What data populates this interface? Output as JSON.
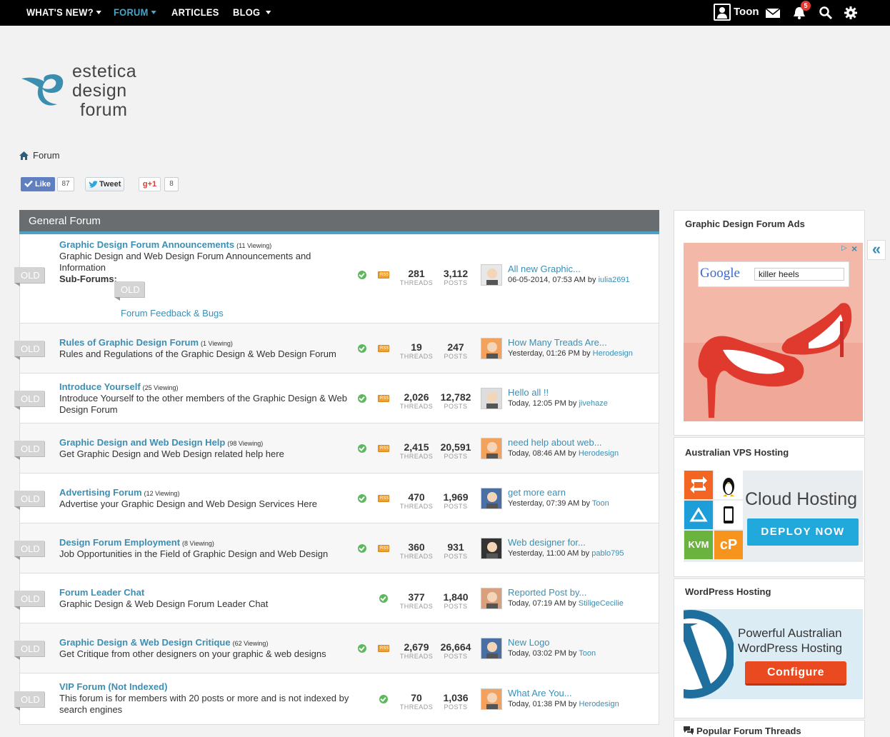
{
  "nav": {
    "whats_new": "WHAT'S NEW?",
    "forum": "FORUM",
    "articles": "ARTICLES",
    "blog": "BLOG",
    "user": "Toon",
    "notifications": "5"
  },
  "logo": {
    "line1": "estetica",
    "line2": "design",
    "line3": "forum"
  },
  "breadcrumb": "Forum",
  "social": {
    "like": "Like",
    "like_count": "87",
    "tweet": "Tweet",
    "gplus": "+1",
    "gplus_count": "8"
  },
  "forum": {
    "section": "General Forum",
    "old_label": "OLD",
    "threads_label": "THREADS",
    "posts_label": "POSTS",
    "rows": [
      {
        "title": "Graphic Design Forum Announcements",
        "viewing": "(11 Viewing)",
        "desc": "Graphic Design and Web Design Forum Announcements and Information",
        "subforums_label": "Sub-Forums:",
        "subforum": "Forum Feedback & Bugs",
        "threads": "281",
        "posts": "3,112",
        "lp_title": "All new Graphic...",
        "lp_date": "06-05-2014, 07:53 AM by",
        "lp_user": "iulia2691"
      },
      {
        "title": "Rules of Graphic Design Forum",
        "viewing": "(1 Viewing)",
        "desc": "Rules and Regulations of the Graphic Design & Web Design Forum",
        "threads": "19",
        "posts": "247",
        "lp_title": "How Many Treads Are...",
        "lp_date": "Yesterday, 01:26 PM by",
        "lp_user": "Herodesign"
      },
      {
        "title": "Introduce Yourself",
        "viewing": "(25 Viewing)",
        "desc": "Introduce Yourself to the other members of the Graphic Design & Web Design Forum",
        "threads": "2,026",
        "posts": "12,782",
        "lp_title": "Hello all !!",
        "lp_date": "Today, 12:05 PM by",
        "lp_user": "jivehaze"
      },
      {
        "title": "Graphic Design and Web Design Help",
        "viewing": "(98 Viewing)",
        "desc": "Get Graphic Design and Web Design related help here",
        "threads": "2,415",
        "posts": "20,591",
        "lp_title": "need help about web...",
        "lp_date": "Today, 08:46 AM by",
        "lp_user": "Herodesign"
      },
      {
        "title": "Advertising Forum",
        "viewing": "(12 Viewing)",
        "desc": "Advertise your Graphic Design and Web Design Services Here",
        "threads": "470",
        "posts": "1,969",
        "lp_title": "get more earn",
        "lp_date": "Yesterday, 07:39 AM by",
        "lp_user": "Toon"
      },
      {
        "title": "Design Forum Employment",
        "viewing": "(8 Viewing)",
        "desc": "Job Opportunities in the Field of Graphic Design and Web Design",
        "threads": "360",
        "posts": "931",
        "lp_title": "Web designer for...",
        "lp_date": "Yesterday, 11:00 AM by",
        "lp_user": "pablo795"
      },
      {
        "title": "Forum Leader Chat",
        "viewing": "",
        "desc": "Graphic Design & Web Design Forum Leader Chat",
        "threads": "377",
        "posts": "1,840",
        "lp_title": "Reported Post by...",
        "lp_date": "Today, 07:19 AM by",
        "lp_user": "StiligeCecilie"
      },
      {
        "title": "Graphic Design & Web Design Critique",
        "viewing": "(62 Viewing)",
        "desc": "Get Critique from other designers on your graphic & web designs",
        "threads": "2,679",
        "posts": "26,664",
        "lp_title": "New Logo",
        "lp_date": "Today, 03:02 PM by",
        "lp_user": "Toon"
      },
      {
        "title": "VIP Forum (Not Indexed)",
        "viewing": "",
        "desc": "This forum is for members with 20 posts or more and is not indexed by search engines",
        "threads": "70",
        "posts": "1,036",
        "lp_title": "What Are You...",
        "lp_date": "Today, 01:38 PM by",
        "lp_user": "Herodesign"
      }
    ]
  },
  "sidebar": {
    "ads_title": "Graphic Design Forum Ads",
    "google_text": "Google",
    "search_value": "killer heels",
    "vps_title": "Australian VPS Hosting",
    "cloud_text": "Cloud Hosting",
    "deploy": "DEPLOY NOW",
    "kvm": "KVM",
    "cp": "cP",
    "wp_title": "WordPress Hosting",
    "wp_line1": "Powerful Australian",
    "wp_line2": "WordPress Hosting",
    "configure": "Configure",
    "popular_title": "Popular Forum Threads"
  },
  "colors": {
    "accent": "#3b8fb5",
    "nav_active": "#45a6c9",
    "header": "#6a6d6f",
    "status": "#5cb85c"
  }
}
